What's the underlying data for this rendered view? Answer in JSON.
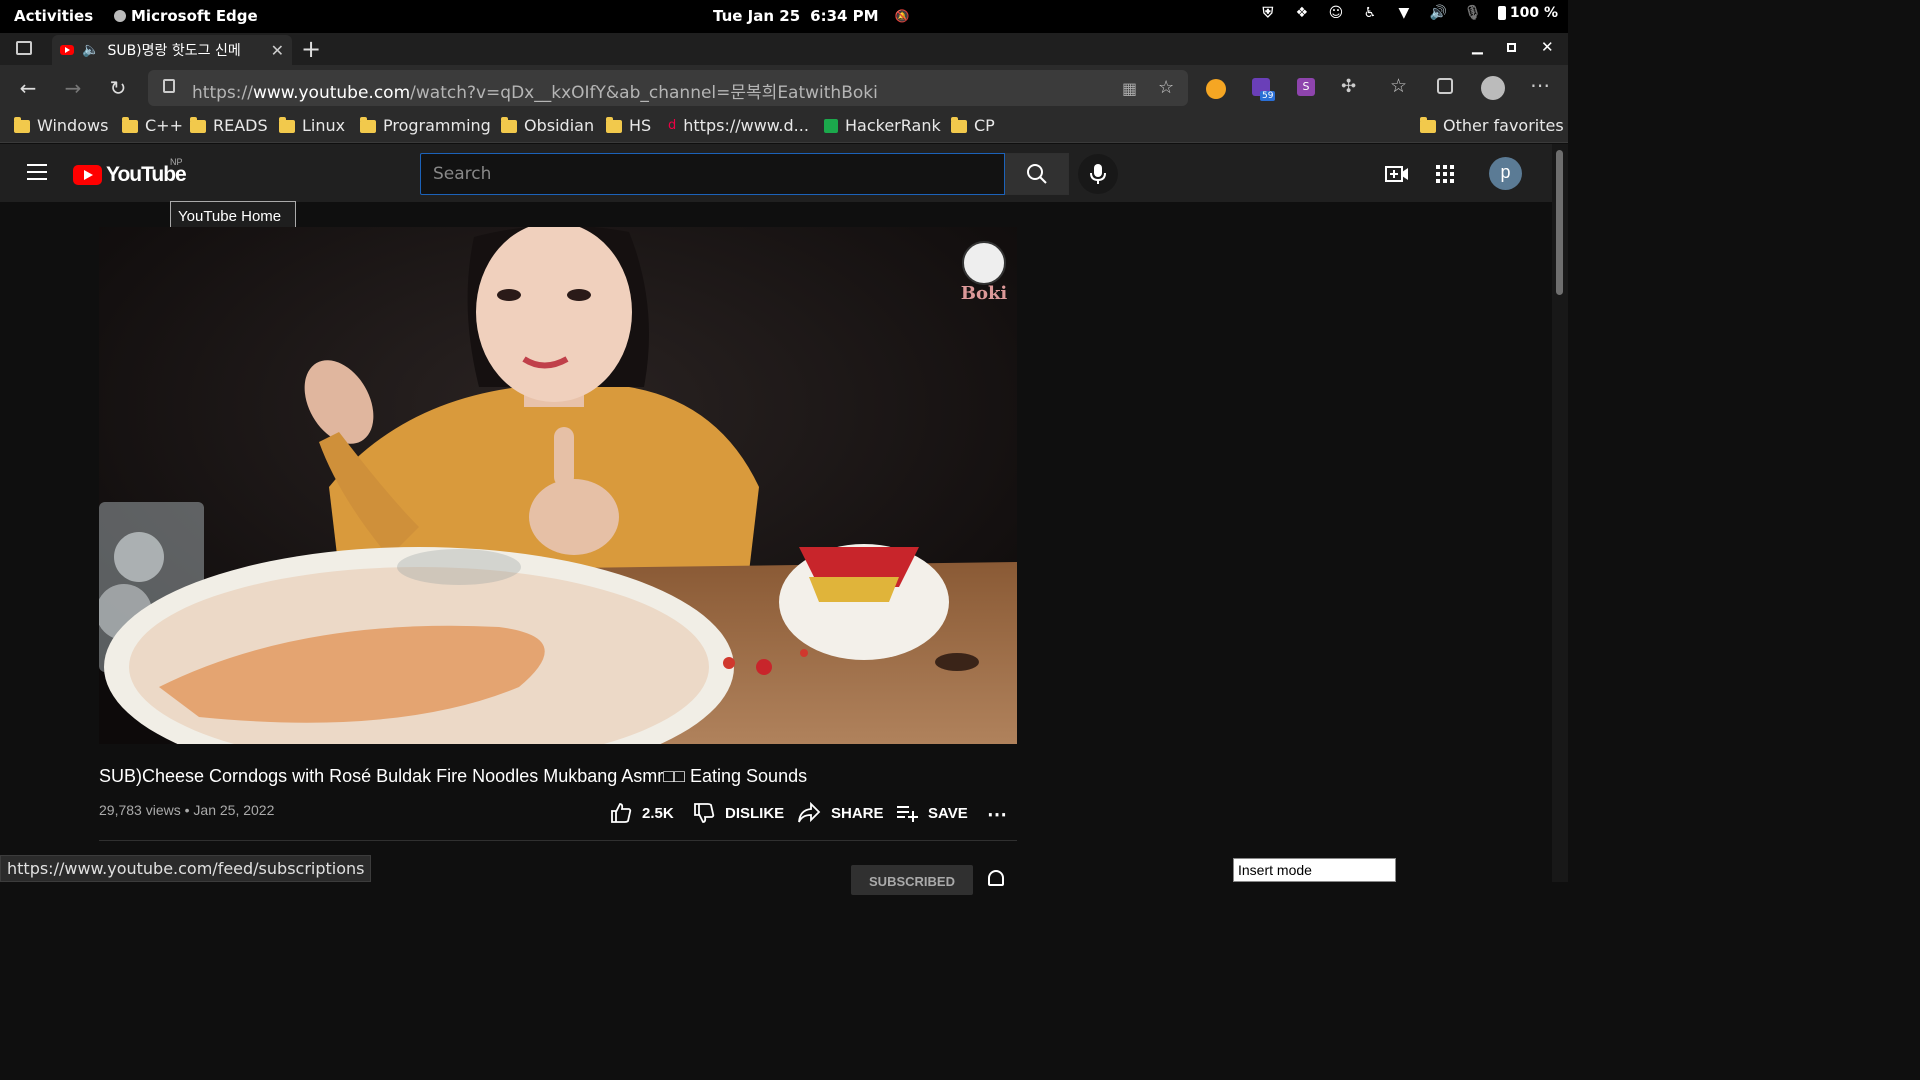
{
  "system_bar": {
    "activities": "Activities",
    "app_name": "Microsoft Edge",
    "date": "Tue Jan 25",
    "time": "6:34 PM",
    "battery": "100 %"
  },
  "browser": {
    "tab_title": "SUB)명랑 핫도그 신메",
    "url_prefix": "https://",
    "url_host": "www.youtube.com",
    "url_path": "/watch?v=qDx__kxOIfY&ab_channel=문복희EatwithBoki",
    "extension_badge": "59",
    "bookmarks": [
      {
        "label": "Windows",
        "icon": "folder-icon"
      },
      {
        "label": "C++",
        "icon": "folder-icon"
      },
      {
        "label": "READS",
        "icon": "folder-icon"
      },
      {
        "label": "Linux",
        "icon": "folder-icon"
      },
      {
        "label": "Programming",
        "icon": "folder-icon"
      },
      {
        "label": "Obsidian",
        "icon": "folder-icon"
      },
      {
        "label": "HS",
        "icon": "folder-icon"
      },
      {
        "label": "https://www.d...",
        "icon": "site-icon"
      },
      {
        "label": "HackerRank",
        "icon": "hackerrank-icon"
      },
      {
        "label": "CP",
        "icon": "folder-icon"
      }
    ],
    "other_favorites": "Other favorites",
    "status_url": "https://www.youtube.com/feed/subscriptions"
  },
  "youtube": {
    "logo_text": "YouTube",
    "country_code": "NP",
    "search_placeholder": "Search",
    "avatar_letter": "p",
    "tooltip": "YouTube Home",
    "video_watermark": "Boki",
    "video_title": "SUB)Cheese Corndogs with Rosé Buldak Fire Noodles Mukbang Asmr□□ Eating Sounds",
    "views": "29,783 views",
    "date": "Jan 25, 2022",
    "likes": "2.5K",
    "dislike_label": "DISLIKE",
    "share_label": "SHARE",
    "save_label": "SAVE",
    "subscribed_label": "SUBSCRIBED"
  },
  "vim": {
    "mode": "Insert mode"
  },
  "colors": {
    "youtube_red": "#ff0000",
    "search_focus": "#1c62b9",
    "background": "#0f0f0f"
  }
}
